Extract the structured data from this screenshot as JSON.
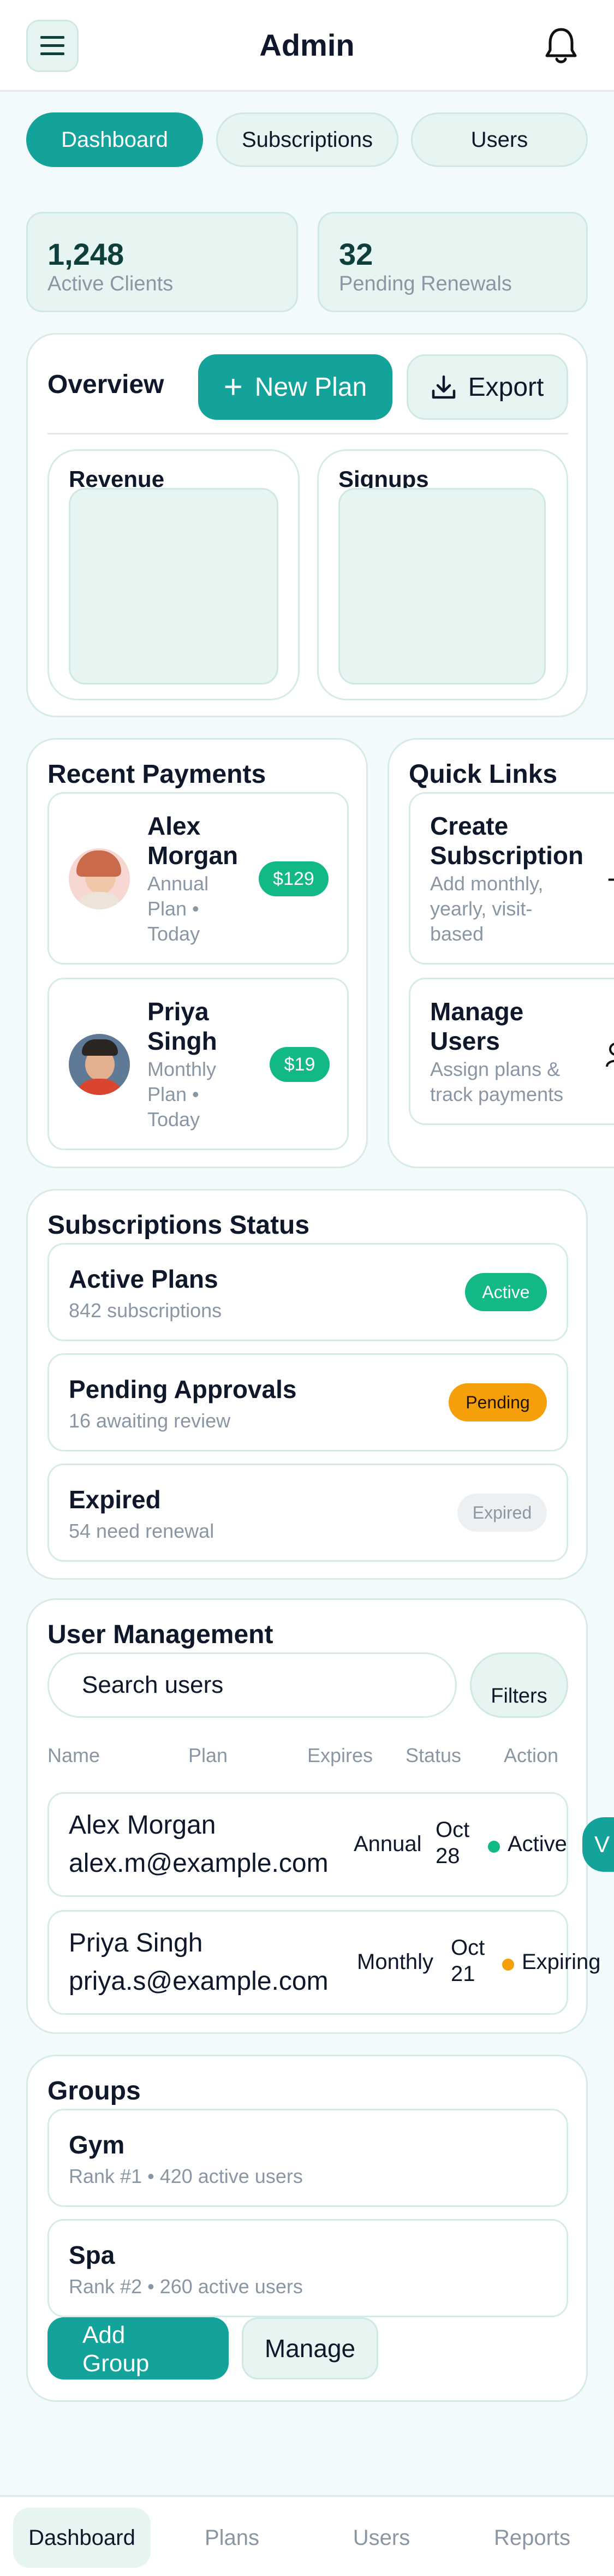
{
  "header": {
    "title": "Admin",
    "menu_icon": "menu-icon",
    "bell_icon": "bell-icon"
  },
  "tabs": [
    {
      "label": "Dashboard"
    },
    {
      "label": "Subscriptions"
    },
    {
      "label": "Users"
    }
  ],
  "stats": [
    {
      "value": "1,248",
      "label": "Active Clients"
    },
    {
      "value": "32",
      "label": "Pending Renewals"
    }
  ],
  "overview": {
    "title": "Overview",
    "new_plan_label": "New Plan",
    "export_label": "Export",
    "charts": [
      {
        "label": "Revenue"
      },
      {
        "label": "Signups"
      }
    ]
  },
  "recent_payments": {
    "title": "Recent Payments",
    "items": [
      {
        "name_line1": "Alex",
        "name_line2": "Morgan",
        "meta1": "Annual",
        "meta2": "Plan •",
        "meta3": "Today",
        "amount": "$129"
      },
      {
        "name_line1": "Priya",
        "name_line2": "Singh",
        "meta1": "Monthly",
        "meta2": "Plan •",
        "meta3": "Today",
        "amount": "$19"
      }
    ]
  },
  "quick_links": {
    "title": "Quick Links",
    "items": [
      {
        "title_line1": "Create",
        "title_line2": "Subscription",
        "desc1": "Add monthly,",
        "desc2": "yearly, visit-",
        "desc3": "based"
      },
      {
        "title_line1": "Manage",
        "title_line2": "Users",
        "desc1": "Assign plans &",
        "desc2": "track payments",
        "desc3": ""
      }
    ]
  },
  "subscriptions_status": {
    "title": "Subscriptions Status",
    "items": [
      {
        "title": "Active Plans",
        "sub": "842 subscriptions",
        "badge": "Active"
      },
      {
        "title": "Pending Approvals",
        "sub": "16 awaiting review",
        "badge": "Pending"
      },
      {
        "title": "Expired",
        "sub": "54 need renewal",
        "badge": "Expired"
      }
    ]
  },
  "user_management": {
    "title": "User Management",
    "search_placeholder": "Search users",
    "filters_label": "Filters",
    "columns": [
      "Name",
      "Plan",
      "Expires",
      "Status",
      "Action"
    ],
    "rows": [
      {
        "name": "Alex Morgan",
        "email": "alex.m@example.com",
        "plan": "Annual",
        "exp1": "Oct",
        "exp2": "28",
        "status": "Active",
        "action": "V"
      },
      {
        "name": "Priya Singh",
        "email": "priya.s@example.com",
        "plan": "Monthly",
        "exp1": "Oct",
        "exp2": "21",
        "status": "Expiring",
        "action": ""
      }
    ]
  },
  "groups": {
    "title": "Groups",
    "items": [
      {
        "title": "Gym",
        "sub": "Rank #1 • 420 active users"
      },
      {
        "title": "Spa",
        "sub": "Rank #2 • 260 active users"
      }
    ],
    "add_label_line1": "Add",
    "add_label_line2": "Group",
    "manage_label": "Manage"
  },
  "bottom_nav": [
    {
      "label": "Dashboard"
    },
    {
      "label": "Plans"
    },
    {
      "label": "Users"
    },
    {
      "label": "Reports"
    }
  ],
  "colors": {
    "accent": "#14a39a",
    "tint": "#e6f5f2",
    "active_green": "#12b886",
    "pending_orange": "#f59f0b",
    "expired_gray": "#eef1f4"
  }
}
